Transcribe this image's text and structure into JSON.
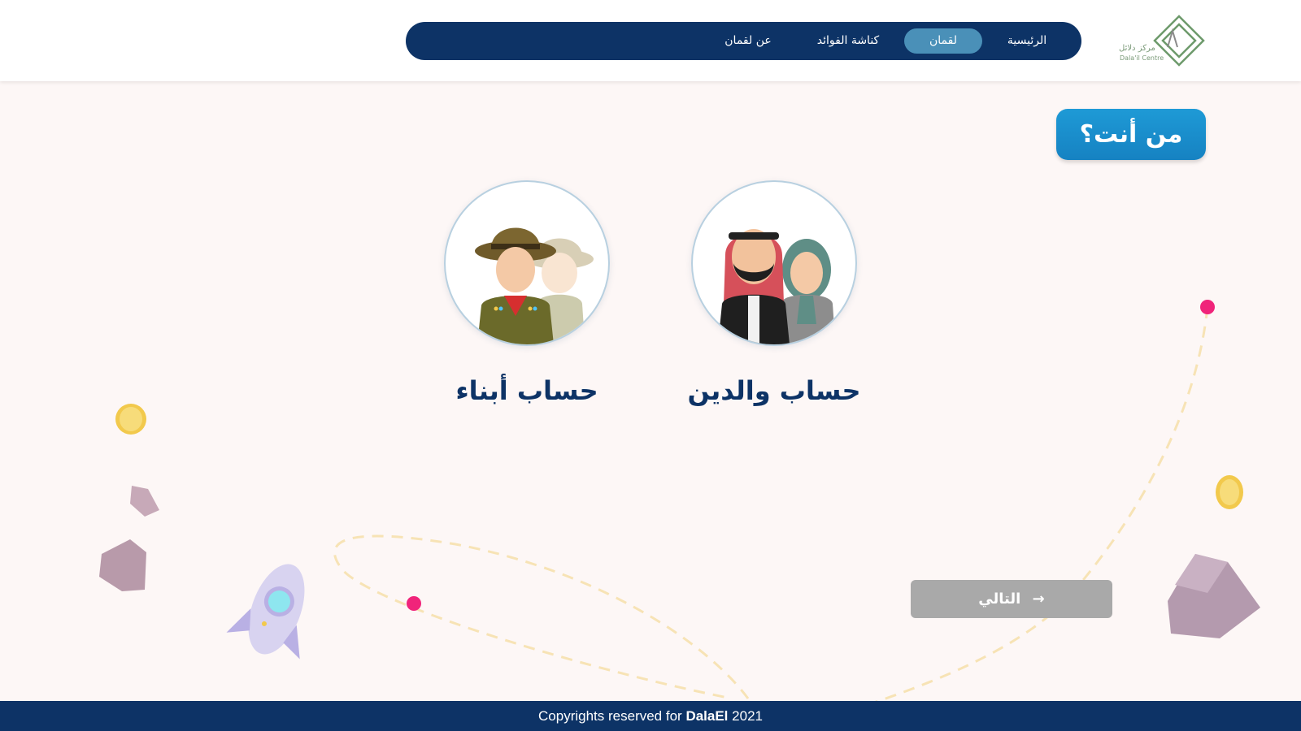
{
  "header": {
    "logo": {
      "arabic": "مركز دلائل",
      "english": "Dala'il Centre"
    },
    "nav": [
      {
        "label": "الرئيسية",
        "active": false
      },
      {
        "label": "لقمان",
        "active": true
      },
      {
        "label": "كناشة الفوائد",
        "active": false
      },
      {
        "label": "عن لقمان",
        "active": false
      }
    ]
  },
  "main": {
    "title": "من أنت؟",
    "accounts": [
      {
        "label": "حساب والدين",
        "icon": "parents-illustration"
      },
      {
        "label": "حساب أبناء",
        "icon": "children-scouts-illustration"
      }
    ],
    "next_button": {
      "label": "التالي",
      "icon": "arrow-right-icon"
    }
  },
  "footer": {
    "prefix": "Copyrights reserved for",
    "brand": "DalaEl",
    "year": "2021"
  },
  "colors": {
    "navy": "#0d3366",
    "active_nav": "#4a90b8",
    "title_blue": "#1e9ad6",
    "background": "#fdf7f6",
    "button_gray": "#a9a9a9",
    "accent_pink": "#f0247a"
  }
}
